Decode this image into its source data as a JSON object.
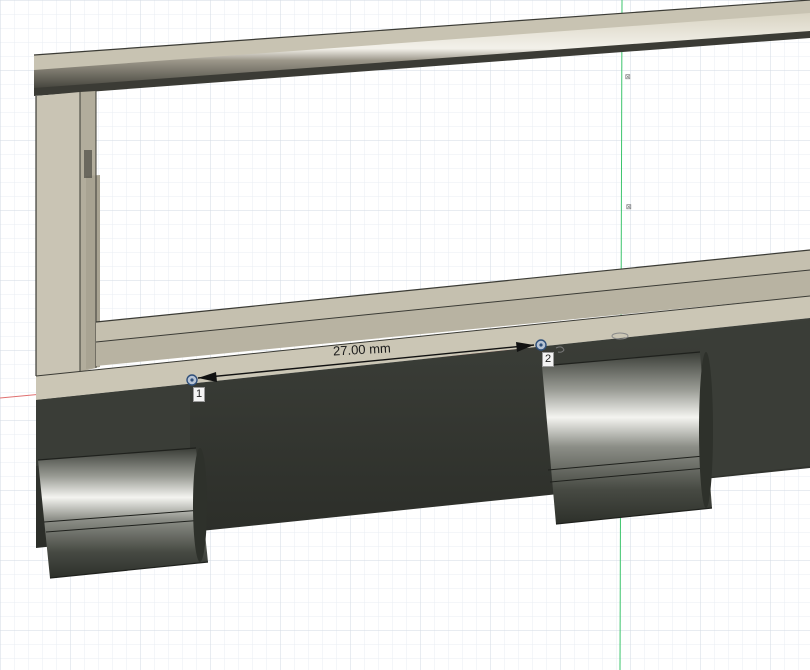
{
  "viewport": {
    "measure_label": "27.00 mm",
    "point_1_label": "1",
    "point_2_label": "2"
  },
  "colors": {
    "grid_minor": "#eef2f6",
    "grid_major": "#d3dbe4",
    "axis_red": "#e06a6a",
    "axis_green": "#37c46a",
    "frame_face": "#c9c4b4",
    "frame_shadow": "#a9a493",
    "frame_edge": "#3b3b35",
    "cylinder_dark": "#2f322c",
    "highlight": "#f2f2ee"
  }
}
